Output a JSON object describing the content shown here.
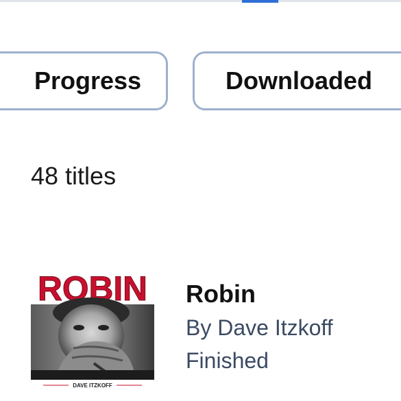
{
  "filters": {
    "progress_label": "Progress",
    "downloaded_label": "Downloaded"
  },
  "library": {
    "count_label": "48 titles"
  },
  "items": [
    {
      "cover_title": "ROBIN",
      "cover_author": "DAVE ITZKOFF",
      "title": "Robin",
      "author": "By Dave Itzkoff",
      "status": "Finished"
    }
  ],
  "colors": {
    "accent": "#2e6fd6",
    "chip_border": "#9db0cc",
    "cover_red": "#c8102e",
    "secondary_text": "#3b4a63"
  }
}
